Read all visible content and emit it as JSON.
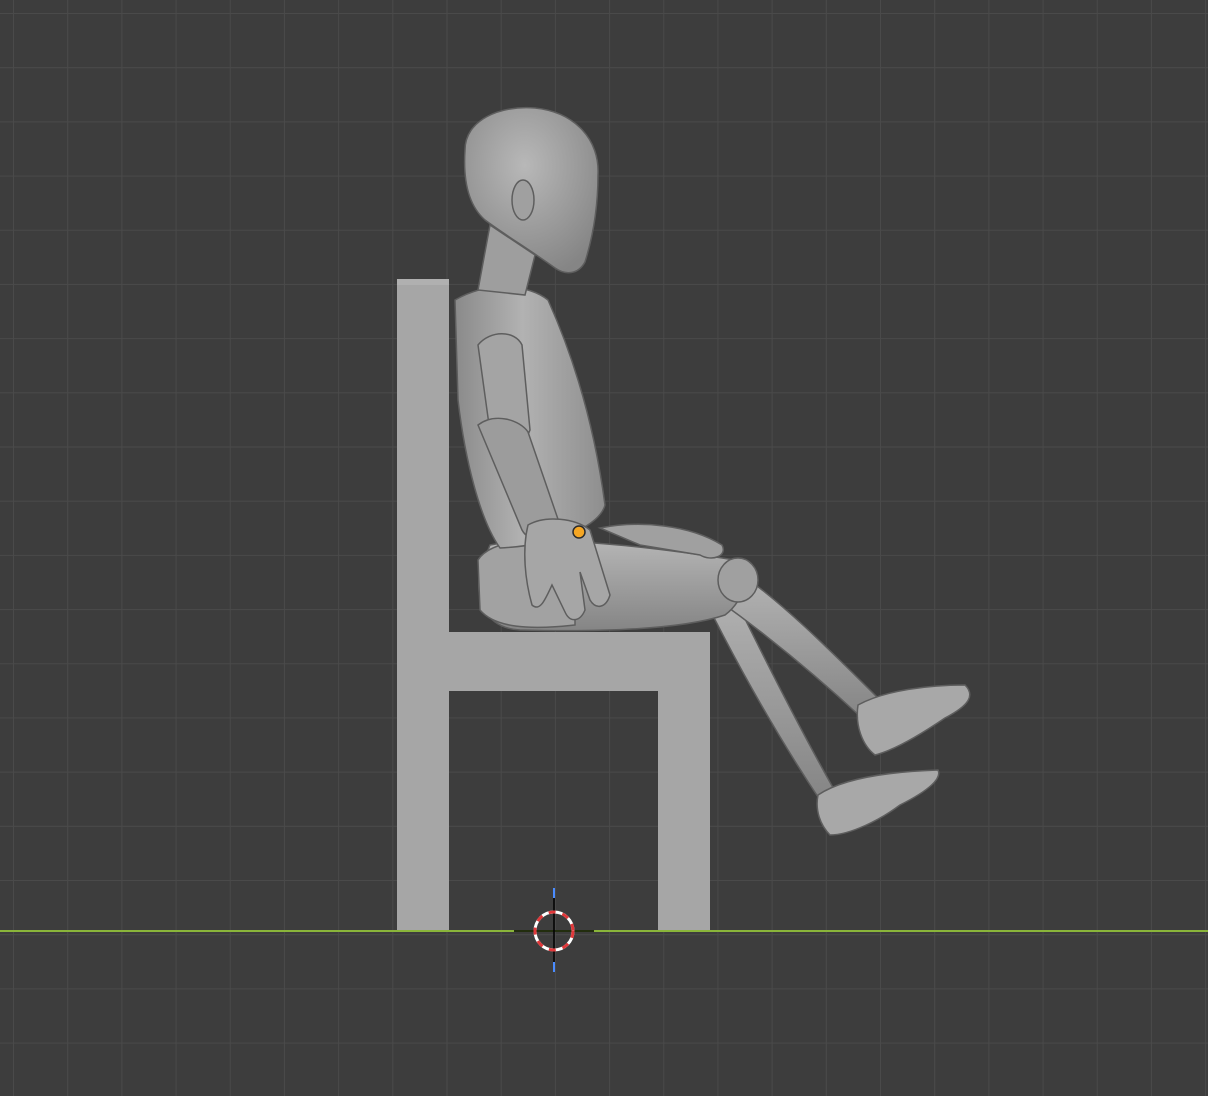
{
  "viewport": {
    "background_color": "#3d3d3d",
    "grid_color": "#4a4a4a",
    "ground_axis_color": "#8ab53a",
    "z_axis_color": "#4a8cff"
  },
  "objects": {
    "chair": {
      "color": "#a6a6a6",
      "shade": "#989898"
    },
    "figure": {
      "color": "#9a9a9a",
      "highlight": "#b4b4b4",
      "shadow": "#777777",
      "edge": "#5e5e5e"
    },
    "origin_point": {
      "color": "#f5a623"
    }
  },
  "cursor_3d": {
    "ring_red": "#e0383a",
    "ring_white": "#ffffff"
  }
}
